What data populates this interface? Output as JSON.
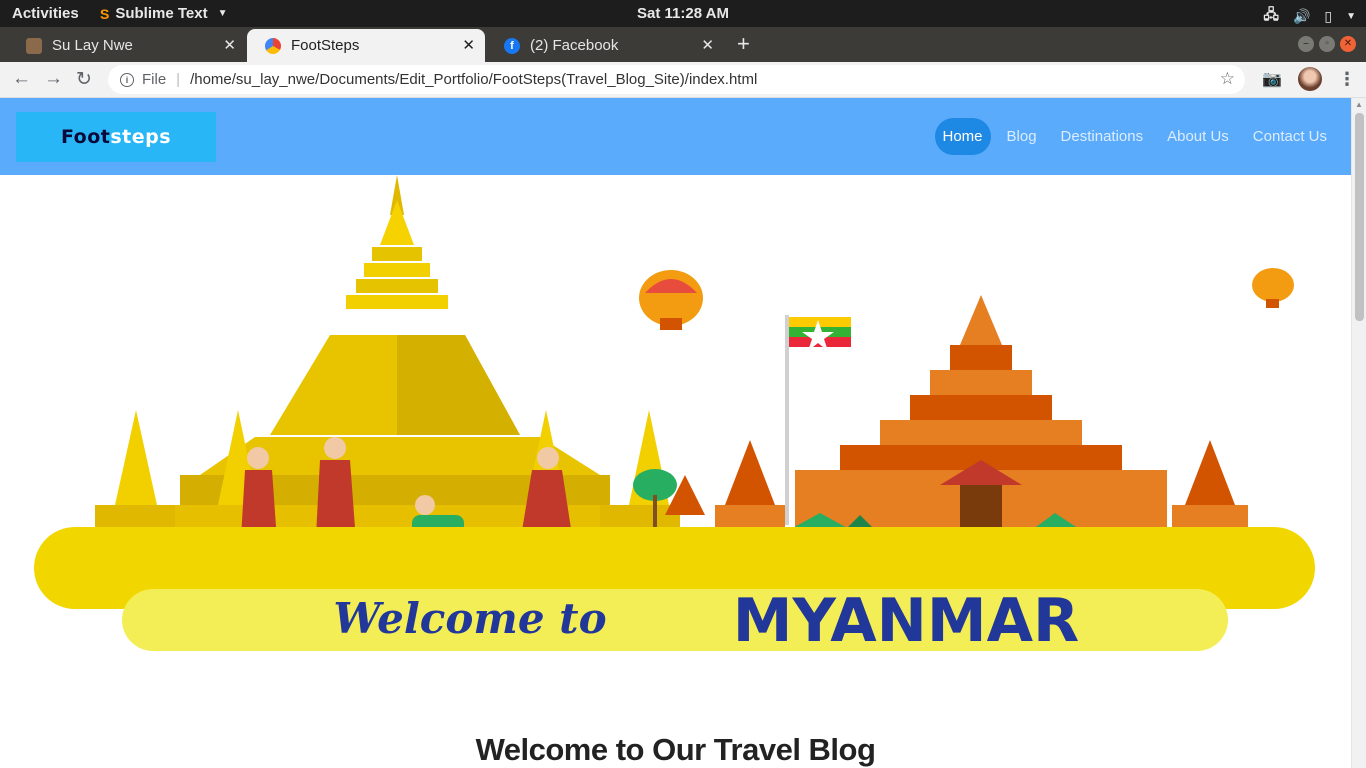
{
  "os": {
    "activities": "Activities",
    "app_name": "Sublime Text",
    "clock": "Sat 11:28 AM"
  },
  "tabs": [
    {
      "title": "Su Lay Nwe"
    },
    {
      "title": "FootSteps"
    },
    {
      "title": "(2) Facebook"
    }
  ],
  "address": {
    "scheme_label": "File",
    "url": "/home/su_lay_nwe/Documents/Edit_Portfolio/FootSteps(Travel_Blog_Site)/index.html"
  },
  "site": {
    "logo": "Footsteps",
    "nav": [
      "Home",
      "Blog",
      "Destinations",
      "About Us",
      "Contact Us"
    ],
    "active_nav": "Home",
    "hero": {
      "welcome_script": "Welcome to",
      "country": "MYANMAR"
    },
    "heading": "Welcome to Our Travel Blog"
  },
  "colors": {
    "nav_bg": "#5aabfb",
    "logo_bg": "#29b6f6",
    "active_nav": "#1e88e5",
    "hero_yellow": "#f2d600",
    "hero_text": "#22379a"
  }
}
